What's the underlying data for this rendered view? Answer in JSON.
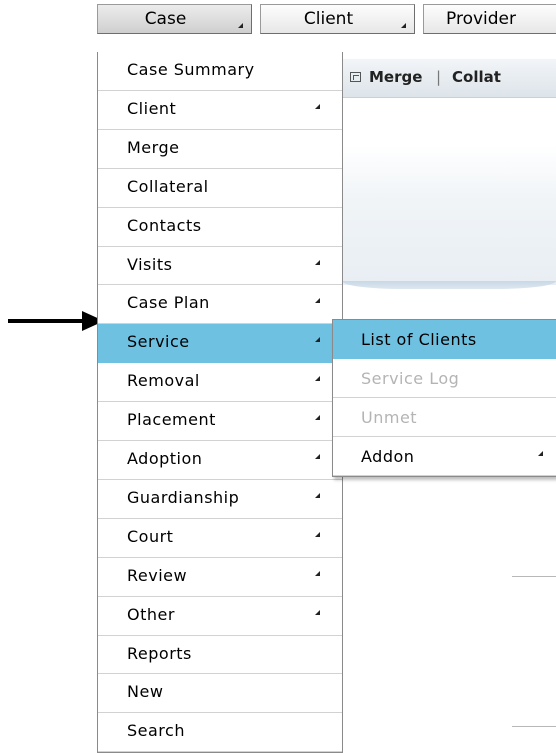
{
  "topbar": {
    "buttons": [
      "Case",
      "Client",
      "Provider"
    ]
  },
  "background": {
    "toolbar": {
      "merge": "Merge",
      "separator": "|",
      "collat": "Collat"
    }
  },
  "menu": {
    "items": [
      {
        "label": "Case Summary"
      },
      {
        "label": "Client",
        "submenu": true
      },
      {
        "label": "Merge"
      },
      {
        "label": "Collateral"
      },
      {
        "label": "Contacts"
      },
      {
        "label": "Visits",
        "submenu": true
      },
      {
        "label": "Case Plan",
        "submenu": true
      },
      {
        "label": "Service",
        "submenu": true,
        "active": true
      },
      {
        "label": "Removal",
        "submenu": true
      },
      {
        "label": "Placement",
        "submenu": true
      },
      {
        "label": "Adoption",
        "submenu": true
      },
      {
        "label": "Guardianship",
        "submenu": true
      },
      {
        "label": "Court",
        "submenu": true
      },
      {
        "label": "Review",
        "submenu": true
      },
      {
        "label": "Other",
        "submenu": true
      },
      {
        "label": "Reports"
      },
      {
        "label": "New"
      },
      {
        "label": "Search"
      }
    ]
  },
  "submenu": {
    "items": [
      {
        "label": "List of Clients",
        "active": true
      },
      {
        "label": "Service Log",
        "disabled": true
      },
      {
        "label": "Unmet",
        "disabled": true
      },
      {
        "label": "Addon",
        "submenu": true
      }
    ]
  },
  "colors": {
    "highlight": "#6fc1e2",
    "disabled_text": "#b4b4b4"
  },
  "annotation": {
    "arrow_icon": "right-arrow-icon"
  }
}
